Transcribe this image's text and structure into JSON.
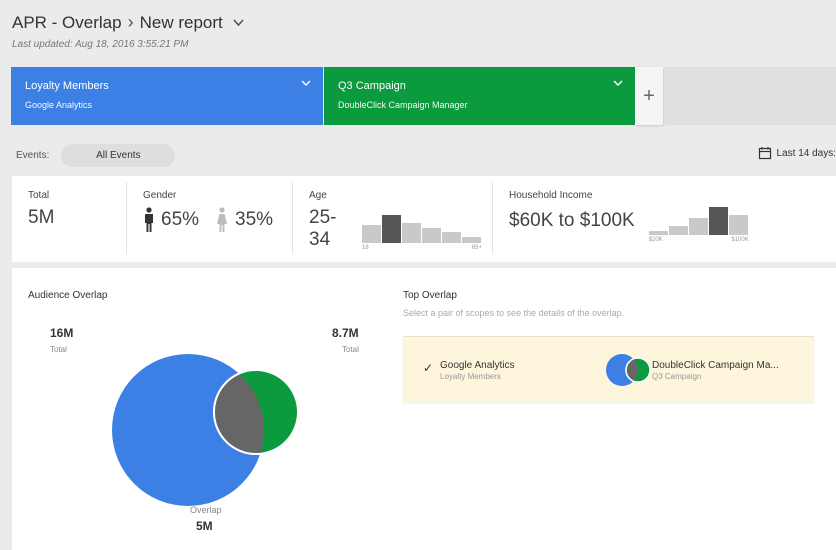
{
  "header": {
    "title_part1": "APR - Overlap",
    "title_sep": "›",
    "title_part2": "New report",
    "last_updated": "Last updated: Aug 18, 2016 3:55:21 PM"
  },
  "scopes": [
    {
      "name": "Loyalty Members",
      "source": "Google Analytics",
      "color": "#3c80e6"
    },
    {
      "name": "Q3 Campaign",
      "source": "DoubleClick Campaign Manager",
      "color": "#0c9a3e"
    }
  ],
  "add_scope_label": "+",
  "events": {
    "label": "Events:",
    "selected": "All Events"
  },
  "date_range": "Last 14 days:",
  "stats": {
    "total": {
      "label": "Total",
      "value": "5M"
    },
    "gender": {
      "label": "Gender",
      "male": "65%",
      "female": "35%"
    },
    "age": {
      "label": "Age",
      "value": "25-34",
      "axis_min": "18",
      "axis_max": "65+",
      "histogram": [
        0.65,
        1.0,
        0.72,
        0.55,
        0.38,
        0.22
      ]
    },
    "income": {
      "label": "Household Income",
      "value": "$60K to $100K",
      "axis_min": "$20K",
      "axis_max": "$100K",
      "histogram": [
        0.15,
        0.32,
        0.62,
        1.0,
        0.72
      ]
    }
  },
  "audience_overlap": {
    "title": "Audience Overlap",
    "left_count": "16M",
    "left_caption": "Total",
    "right_count": "8.7M",
    "right_caption": "Total",
    "overlap_caption": "Overlap",
    "overlap_count": "5M"
  },
  "top_overlap": {
    "title": "Top Overlap",
    "subtitle": "Select a pair of scopes to see the details of the overlap.",
    "pair_a_name": "Google Analytics",
    "pair_a_sub": "Loyalty Members",
    "pair_b_name": "DoubleClick Campaign Ma...",
    "pair_b_sub": "Q3 Campaign"
  },
  "colors": {
    "blue": "#3c80e6",
    "green": "#0c9a3e",
    "overlap": "#666666"
  }
}
